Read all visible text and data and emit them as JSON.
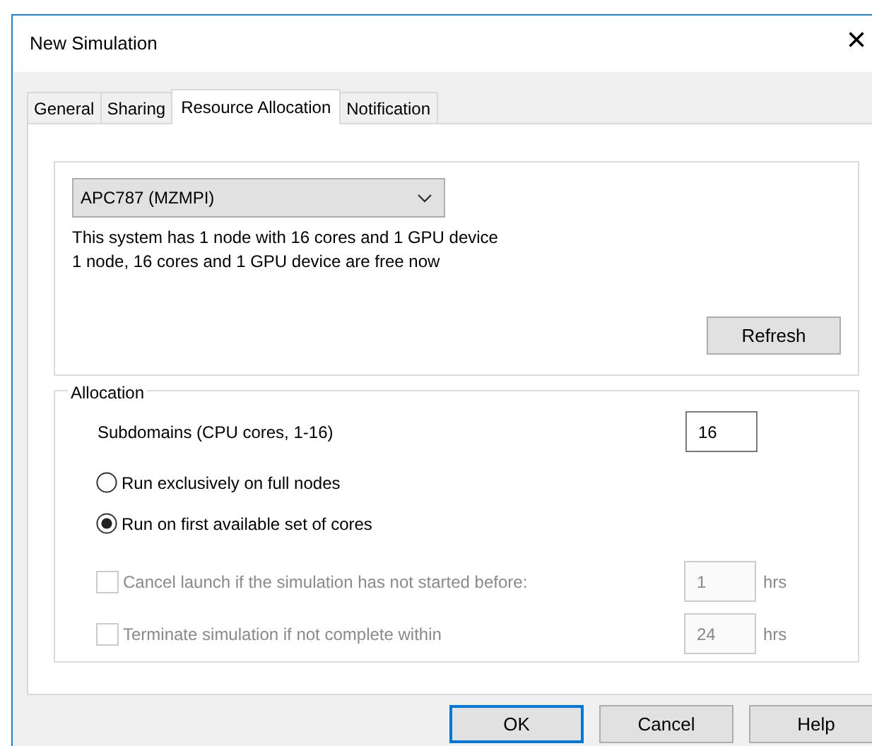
{
  "window": {
    "title": "New Simulation",
    "close": "×"
  },
  "tabs": [
    {
      "label": "General",
      "selected": false
    },
    {
      "label": "Sharing",
      "selected": false
    },
    {
      "label": "Resource Allocation",
      "selected": true
    },
    {
      "label": "Notification",
      "selected": false
    }
  ],
  "system": {
    "value": "APC787 (MZMPI)",
    "info": [
      "This system has 1 node with 16 cores and 1 GPU device",
      "1 node, 16 cores and 1 GPU device are free now"
    ],
    "refresh": "Refresh"
  },
  "allocation": {
    "legend": "Allocation",
    "subdomains": {
      "label": "Subdomains (CPU cores, 1-16)",
      "value": "16"
    },
    "options": [
      {
        "kind": "radio",
        "label": "Run exclusively on full nodes",
        "selected": false
      },
      {
        "kind": "radio",
        "label": "Run on first available set of cores",
        "selected": true
      },
      {
        "kind": "checkbox",
        "label": "Cancel launch if the simulation has not started before:",
        "checked": false,
        "disabled": true,
        "value": "1",
        "unit": "hrs"
      },
      {
        "kind": "checkbox",
        "label": "Terminate simulation if not complete within",
        "checked": false,
        "disabled": true,
        "value": "24",
        "unit": "hrs"
      }
    ]
  },
  "buttons": [
    {
      "label": "OK",
      "default": true
    },
    {
      "label": "Cancel",
      "default": false
    },
    {
      "label": "Help",
      "default": false
    }
  ]
}
